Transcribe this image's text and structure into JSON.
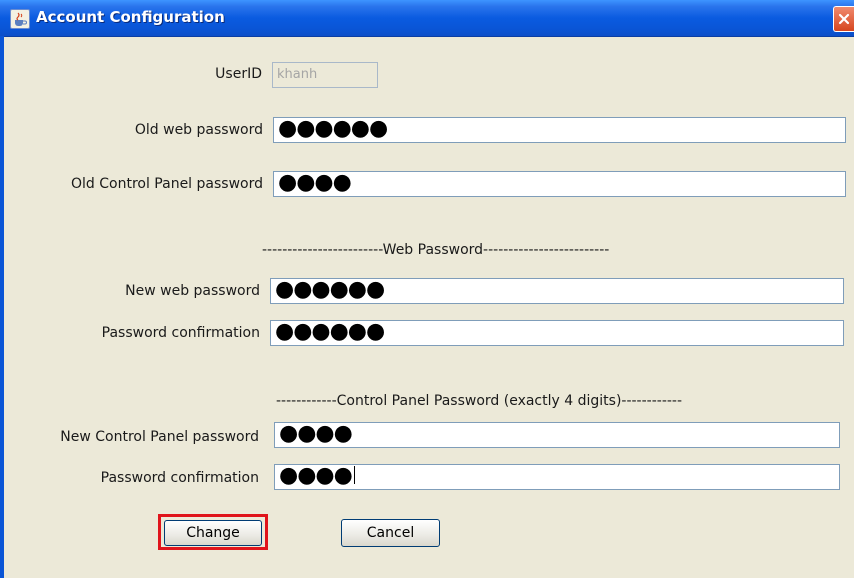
{
  "window": {
    "title": "Account Configuration",
    "title_icon": "java-cup-icon",
    "close_icon": "close-icon"
  },
  "form": {
    "userid": {
      "label": "UserID",
      "value": "khanh",
      "enabled": false
    },
    "old_web_password": {
      "label": "Old web password",
      "value": "●●●●●●"
    },
    "old_cp_password": {
      "label": "Old Control Panel password",
      "value": "●●●●"
    },
    "web_section_header": "------------------------Web Password-------------------------",
    "new_web_password": {
      "label": "New web password",
      "value": "●●●●●●"
    },
    "web_password_confirmation": {
      "label": "Password confirmation",
      "value": "●●●●●●"
    },
    "cp_section_header": "------------Control Panel Password (exactly 4 digits)------------",
    "new_cp_password": {
      "label": "New Control Panel password",
      "value": "●●●●"
    },
    "cp_password_confirmation": {
      "label": "Password confirmation",
      "value": "●●●●"
    }
  },
  "buttons": {
    "change": "Change",
    "cancel": "Cancel"
  },
  "colors": {
    "titlebar": "#0a55d6",
    "dialog_bg": "#ece9d8",
    "highlight": "#e0141b",
    "field_border": "#7f9db9"
  }
}
